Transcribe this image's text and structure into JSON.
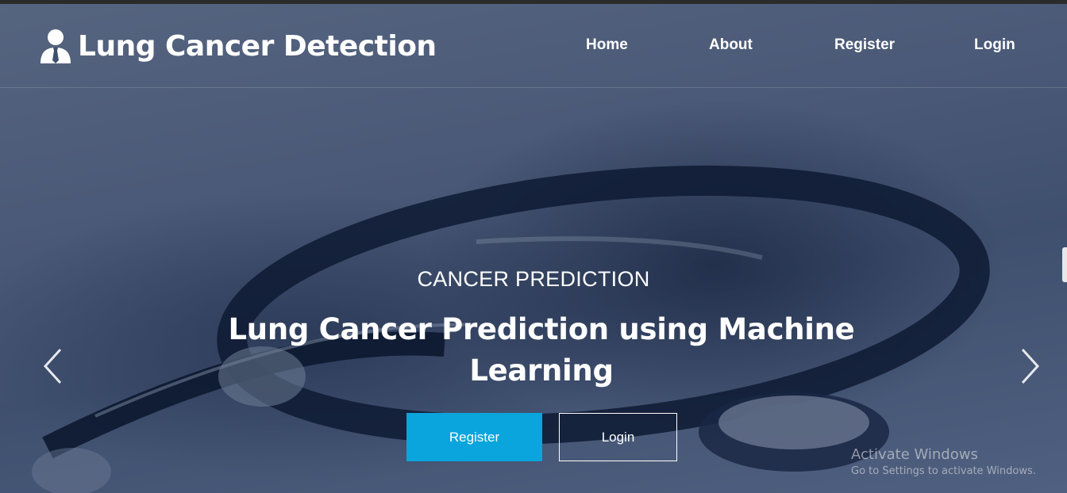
{
  "brand": {
    "title": "Lung Cancer Detection",
    "icon": "user-tie-icon"
  },
  "nav": {
    "home": "Home",
    "about": "About",
    "register": "Register",
    "login": "Login"
  },
  "hero": {
    "subtitle": "CANCER PREDICTION",
    "title": "Lung Cancer Prediction using Machine Learning",
    "register_button": "Register",
    "login_button": "Login",
    "prev_icon": "chevron-left-icon",
    "next_icon": "chevron-right-icon"
  },
  "watermark": {
    "title": "Activate Windows",
    "subtitle": "Go to Settings to activate Windows."
  },
  "colors": {
    "accent": "#0aa5dc",
    "overlay": "#3a4a68",
    "text": "#ffffff"
  }
}
